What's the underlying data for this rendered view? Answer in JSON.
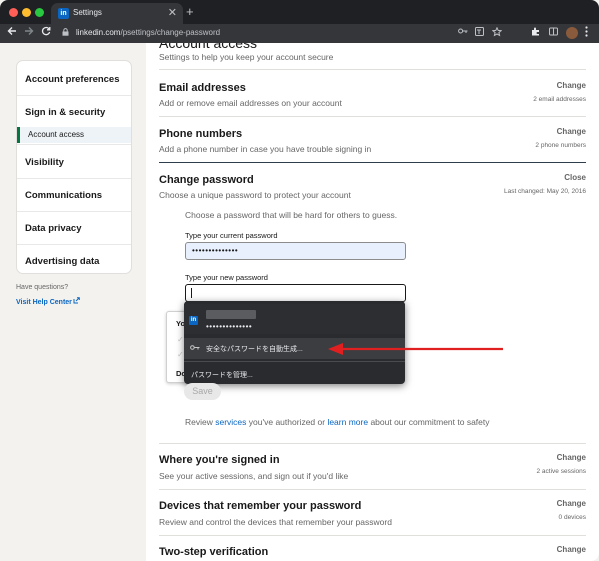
{
  "browser": {
    "tab_title": "Settings",
    "tab_logo": "in",
    "tab_close": "✕",
    "new_tab": "+",
    "url_host": "linkedin.com",
    "url_path": "/psettings/change-password",
    "colors": {
      "window_close": "#ff5f57",
      "window_min": "#febc2e",
      "window_max": "#28c840"
    }
  },
  "sidebar": {
    "items": [
      {
        "label": "Account preferences"
      },
      {
        "label": "Sign in & security"
      },
      {
        "label": "Visibility"
      },
      {
        "label": "Communications"
      },
      {
        "label": "Data privacy"
      },
      {
        "label": "Advertising data"
      }
    ],
    "active_sub": "Account access",
    "help_question": "Have questions?",
    "help_link": "Visit Help Center"
  },
  "main": {
    "page_title": "Account access",
    "page_subtitle": "Settings to help you keep your account secure",
    "email": {
      "title": "Email addresses",
      "desc": "Add or remove email addresses on your account",
      "action": "Change",
      "meta": "2 email addresses"
    },
    "phone": {
      "title": "Phone numbers",
      "desc": "Add a phone number in case you have trouble signing in",
      "action": "Change",
      "meta": "2 phone numbers"
    },
    "password": {
      "title": "Change password",
      "desc": "Choose a unique password to protect your account",
      "action": "Close",
      "meta": "Last changed: May 20, 2016",
      "hint": "Choose a password that will be hard for others to guess.",
      "current_label": "Type your current password",
      "current_value": "••••••••••••••",
      "new_label": "Type your new password",
      "new_value": "",
      "tip_heading": "Yo",
      "tip_footer": "Do",
      "save_label": "Save",
      "review_pre": "Review ",
      "review_link1": "services",
      "review_mid": " you've authorized or ",
      "review_link2": "learn more",
      "review_post": " about our commitment to safety"
    },
    "signed_in": {
      "title": "Where you're signed in",
      "desc": "See your active sessions, and sign out if you'd like",
      "action": "Change",
      "meta": "2 active sessions"
    },
    "devices": {
      "title": "Devices that remember your password",
      "desc": "Review and control the devices that remember your password",
      "action": "Change",
      "meta": "0 devices"
    },
    "two_step": {
      "title": "Two-step verification",
      "action": "Change"
    }
  },
  "autofill": {
    "saved_password": "••••••••••••••",
    "suggest": "安全なパスワードを自動生成...",
    "manage": "パスワードを管理..."
  },
  "annotation": {
    "arrow_color": "#e02020"
  }
}
